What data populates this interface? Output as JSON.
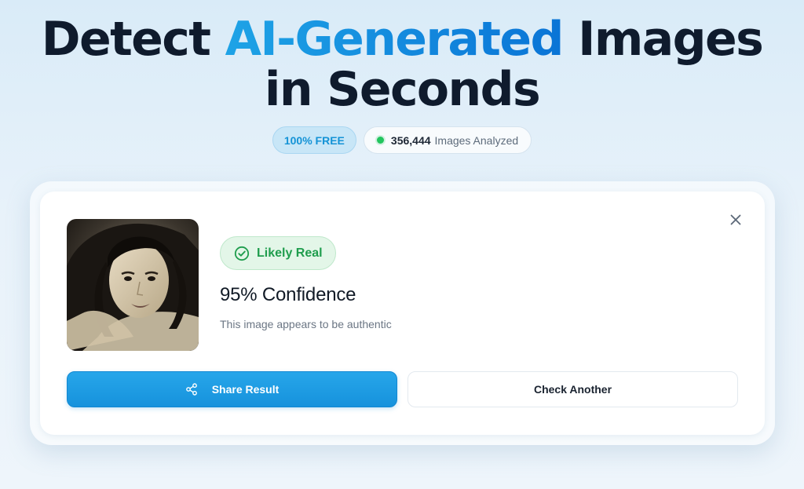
{
  "hero": {
    "title_part1": "Detect ",
    "title_accent": "AI-Generated",
    "title_part2": " Images",
    "title_line2": "in Seconds"
  },
  "badges": {
    "free_label": "100% FREE",
    "count_value": "356,444",
    "count_label": "Images Analyzed"
  },
  "result": {
    "image_alt": "Uploaded image",
    "status_label": "Likely Real",
    "confidence_text": "95% Confidence",
    "description": "This image appears to be authentic",
    "share_label": "Share Result",
    "check_another_label": "Check Another"
  },
  "icons": {
    "close": "close-icon",
    "status": "check-circle-icon",
    "share": "share-icon",
    "indicator": "live-dot-icon"
  },
  "colors": {
    "accent_blue": "#1493d6",
    "success_green": "#1f9d4d",
    "heading_dark": "#0f1b2d"
  }
}
